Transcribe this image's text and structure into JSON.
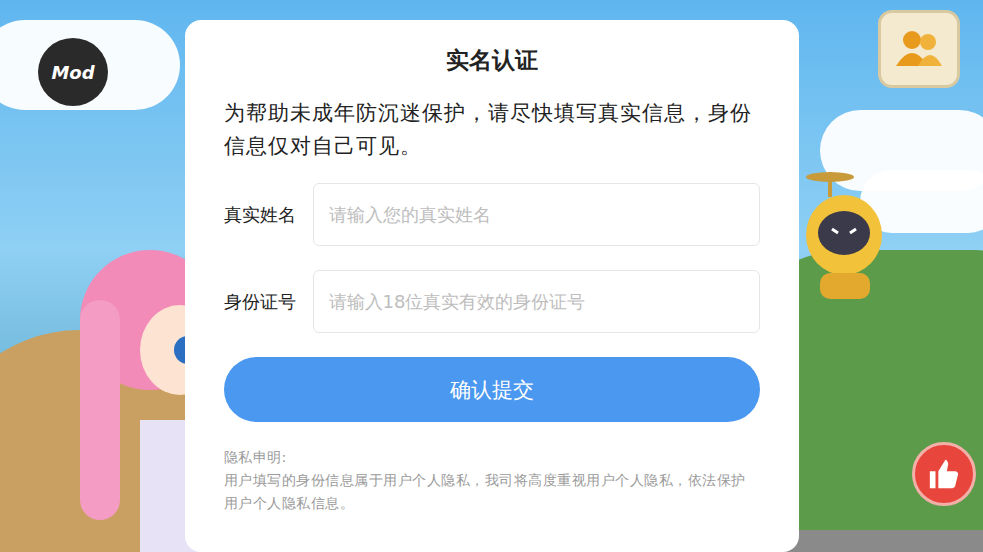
{
  "hud": {
    "mod_button": "Mod"
  },
  "dialog": {
    "title": "实名认证",
    "description": "为帮助未成年防沉迷保护，请尽快填写真实信息，身份信息仅对自己可见。",
    "fields": [
      {
        "label": "真实姓名",
        "placeholder": "请输入您的真实姓名"
      },
      {
        "label": "身份证号",
        "placeholder": "请输入18位真实有效的身份证号"
      }
    ],
    "submit": "确认提交",
    "privacy": {
      "title": "隐私申明:",
      "text": "用户填写的身份信息属于用户个人隐私，我司将高度重视用户个人隐私，依法保护用户个人隐私信息。"
    }
  }
}
